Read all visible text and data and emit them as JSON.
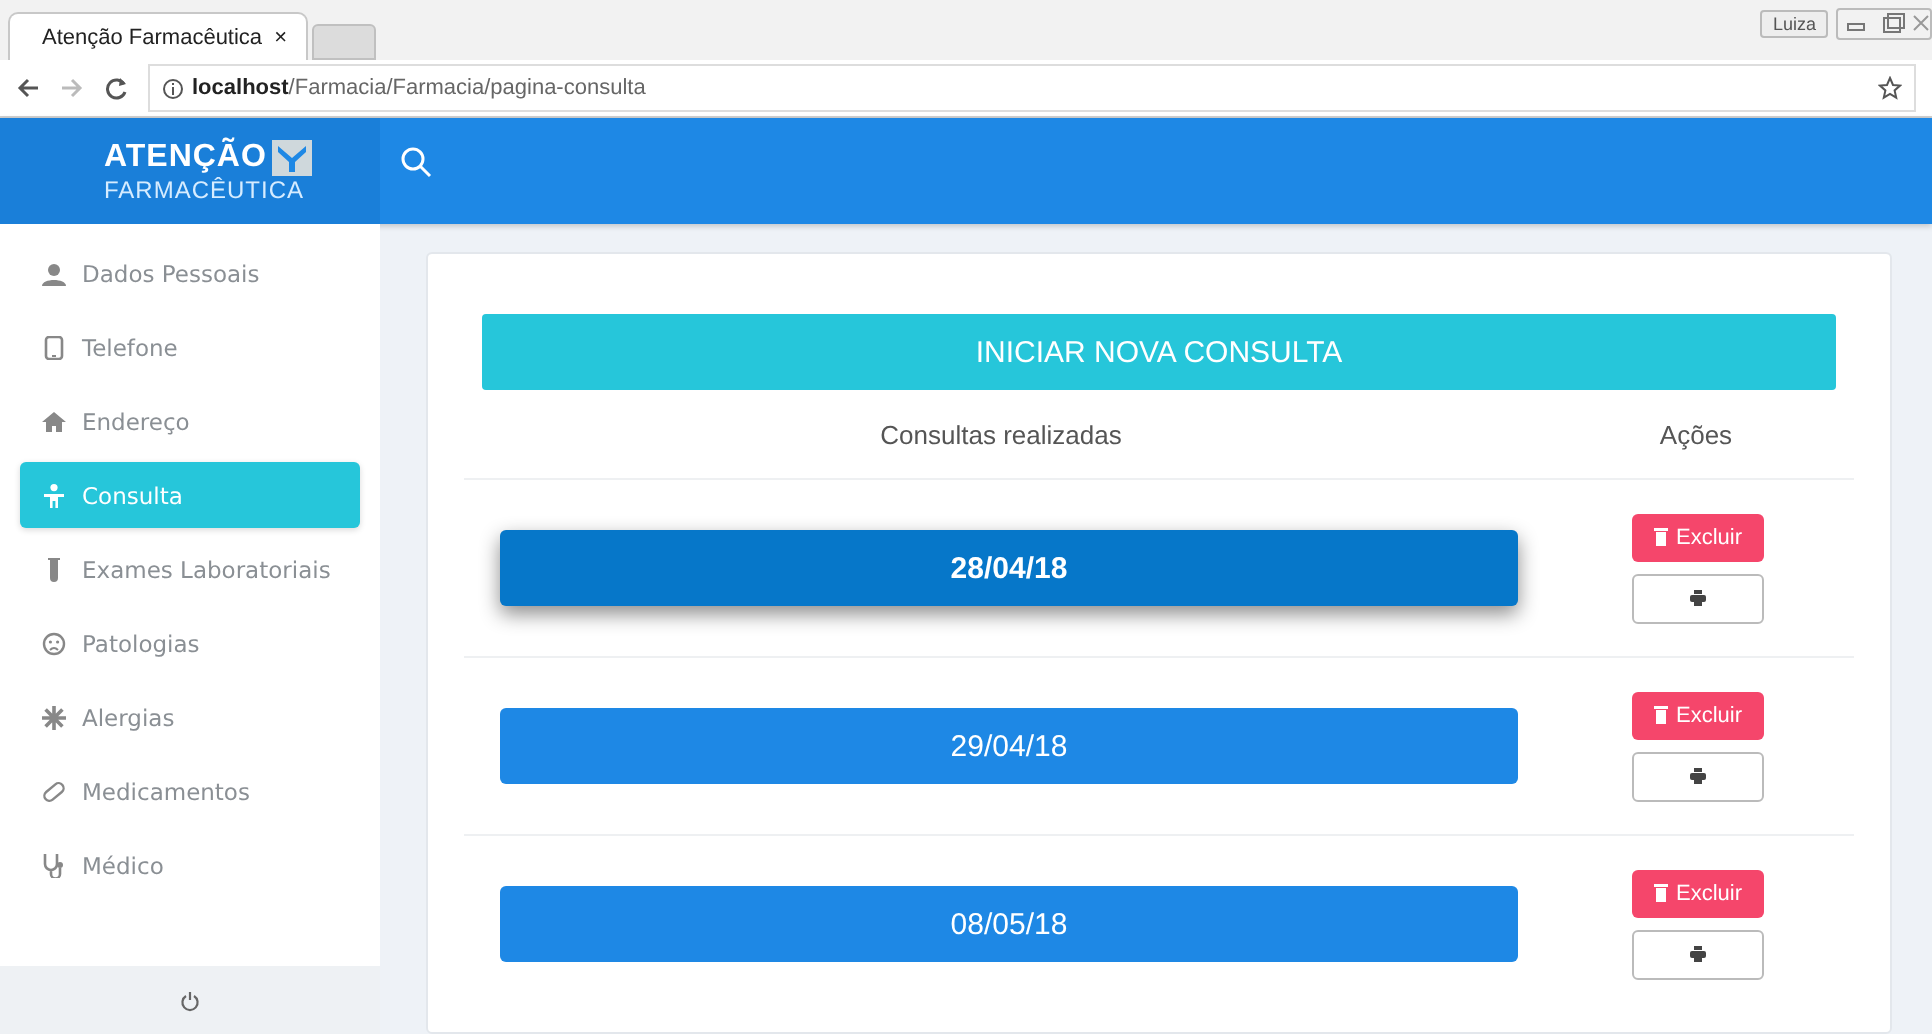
{
  "browser": {
    "tab_title": "Atenção Farmacêutica",
    "tab_close": "×",
    "user_badge": "Luiza",
    "address_host": "localhost",
    "address_path": "/Farmacia/Farmacia/pagina-consulta"
  },
  "header": {
    "logo_top": "ATENÇÃO",
    "logo_bottom": "FARMACÊUTICA"
  },
  "sidebar": {
    "items": [
      {
        "label": "Dados Pessoais",
        "selected": false
      },
      {
        "label": "Telefone",
        "selected": false
      },
      {
        "label": "Endereço",
        "selected": false
      },
      {
        "label": "Consulta",
        "selected": true
      },
      {
        "label": "Exames Laboratoriais",
        "selected": false
      },
      {
        "label": "Patologias",
        "selected": false
      },
      {
        "label": "Alergias",
        "selected": false
      },
      {
        "label": "Medicamentos",
        "selected": false
      },
      {
        "label": "Médico",
        "selected": false
      }
    ]
  },
  "main": {
    "new_button": "INICIAR NOVA CONSULTA",
    "columns": [
      "Consultas realizadas",
      "Ações"
    ],
    "rows": [
      {
        "date": "28/04/18",
        "delete": "Excluir",
        "raised": true
      },
      {
        "date": "29/04/18",
        "delete": "Excluir",
        "raised": false
      },
      {
        "date": "08/05/18",
        "delete": "Excluir",
        "raised": false
      }
    ]
  }
}
